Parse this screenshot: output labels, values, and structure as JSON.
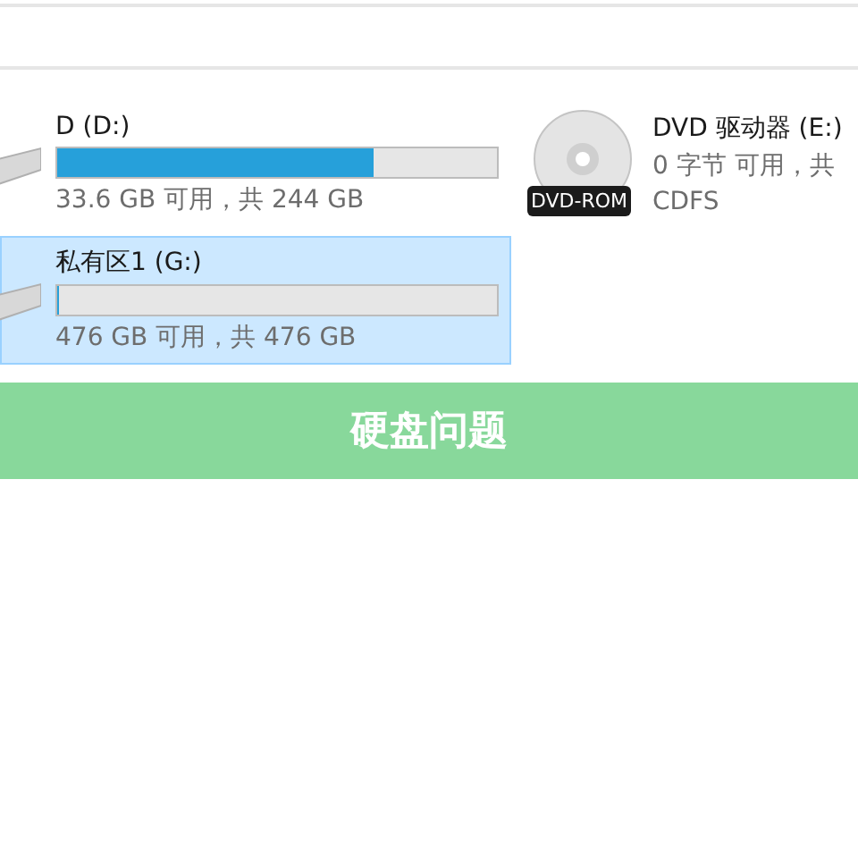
{
  "drives": [
    {
      "kind": "disk",
      "name": "D (D:)",
      "level": 0.72,
      "detail": "33.6 GB 可用，共 244 GB",
      "selected": false
    },
    {
      "kind": "dvd",
      "name": "DVD 驱动器 (E:)",
      "badge": "DVD-ROM",
      "detail": "0 字节 可用，共",
      "filesystem": "CDFS",
      "selected": false
    },
    {
      "kind": "disk",
      "name": "私有区1 (G:)",
      "level": 0,
      "detail": "476 GB 可用，共 476 GB",
      "selected": true
    }
  ],
  "banner": {
    "title": "硬盘问题"
  }
}
